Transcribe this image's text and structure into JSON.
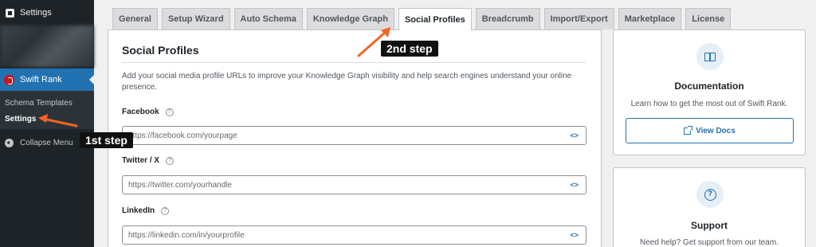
{
  "sidebar": {
    "settings_label": "Settings",
    "active_plugin_label": "Swift Rank",
    "submenu": [
      "Schema Templates",
      "Settings"
    ],
    "collapse_label": "Collapse Menu"
  },
  "tabs": [
    {
      "label": "General"
    },
    {
      "label": "Setup Wizard"
    },
    {
      "label": "Auto Schema"
    },
    {
      "label": "Knowledge Graph"
    },
    {
      "label": "Social Profiles",
      "active": true
    },
    {
      "label": "Breadcrumb"
    },
    {
      "label": "Import/Export"
    },
    {
      "label": "Marketplace"
    },
    {
      "label": "License"
    }
  ],
  "main": {
    "title": "Social Profiles",
    "description": "Add your social media profile URLs to improve your Knowledge Graph visibility and help search engines understand your online presence.",
    "fields": [
      {
        "label": "Facebook",
        "value": "https://facebook.com/yourpage"
      },
      {
        "label": "Twitter / X",
        "value": "https://twitter.com/yourhandle"
      },
      {
        "label": "LinkedIn",
        "value": "https://linkedin.com/in/yourprofile"
      }
    ]
  },
  "documentation": {
    "icon": "book-icon",
    "title": "Documentation",
    "text": "Learn how to get the most out of Swift Rank.",
    "button_label": "View Docs"
  },
  "support": {
    "icon": "help-circle-icon",
    "title": "Support",
    "text": "Need help? Get support from our team."
  },
  "annotations": {
    "step1": "1st step",
    "step2": "2nd step",
    "arrow_color": "#f26522"
  },
  "colors": {
    "accent": "#2271b1",
    "sidebar_bg": "#1d2327",
    "active_menu_bg": "#2271b1"
  }
}
